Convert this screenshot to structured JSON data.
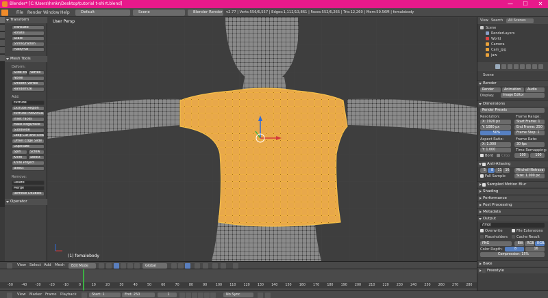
{
  "window": {
    "title": "Blender* [C:\\Users\\hmkr\\Desktop\\tutorial t-shirt.blend]",
    "minimize": "—",
    "maximize": "☐",
    "close": "✕"
  },
  "menubar": {
    "items": [
      "File",
      "Render",
      "Window",
      "Help"
    ],
    "screen_layout": "Default",
    "scene": "Scene",
    "engine": "Blender Render",
    "stats": "v2.77 | Verts:556/6,557 | Edges:1,112/13,861 | Faces:552/6,265 | Tris:12,260 | Mem:59.56M | femalebody"
  },
  "left_tabs": [
    "Tools",
    "Create",
    "Relations",
    "Animation",
    "Physics",
    "Grease Pencil"
  ],
  "tool_shelf": {
    "transform_header": "Transform",
    "transform_buttons": [
      "Translate",
      "Rotate",
      "Scale",
      "Shrink/Fatten",
      "Push/Pull"
    ],
    "mesh_tools_header": "Mesh Tools",
    "deform_label": "Deform:",
    "deform_buttons": [
      "Slide Ed",
      "Vertex",
      "Noise",
      "Smooth Vertex",
      "Randomize"
    ],
    "add_label": "Add:",
    "add_buttons": [
      "Extrude",
      "Extrude Region",
      "Extrude Individual",
      "Inset Faces",
      "Make Edge/Face",
      "Subdivide",
      "Loop Cut and Slide",
      "Offset Edge Slide",
      "Duplicate",
      "Spin",
      "Screw",
      "Knife",
      "Select",
      "Knife Project",
      "Bisect"
    ],
    "remove_label": "Remove:",
    "remove_buttons": [
      "Delete",
      "Merge",
      "Remove Doubles"
    ],
    "operator_header": "Operator"
  },
  "viewport": {
    "view_label": "User Persp",
    "object_label": "(1) femalebody"
  },
  "view3d_header": {
    "view": "View",
    "select": "Select",
    "add": "Add",
    "mesh": "Mesh",
    "mode": "Edit Mode",
    "orientation": "Global"
  },
  "timeline": {
    "ticks": [
      "-50",
      "-40",
      "-30",
      "-20",
      "-10",
      "0",
      "10",
      "20",
      "30",
      "40",
      "50",
      "60",
      "70",
      "80",
      "90",
      "100",
      "110",
      "120",
      "130",
      "140",
      "150",
      "160",
      "170",
      "180",
      "190",
      "200",
      "210",
      "220",
      "230",
      "240",
      "250",
      "260",
      "270",
      "280"
    ],
    "current_frame": 1
  },
  "bottom_bar": {
    "view": "View",
    "marker": "Marker",
    "frame": "Frame",
    "playback": "Playback",
    "start": "Start:",
    "start_value": "1",
    "end": "End:",
    "end_value": "250",
    "current": "1",
    "sync": "No Sync"
  },
  "outliner": {
    "view": "View",
    "search": "Search",
    "all_scenes": "All Scenes",
    "items": [
      {
        "label": "Scene",
        "color": "#c9c9c9"
      },
      {
        "label": "RenderLayers",
        "color": "#8aa0c8"
      },
      {
        "label": "World",
        "color": "#d44"
      },
      {
        "label": "Camera",
        "color": "#e9a23b"
      },
      {
        "label": "Cam_Jpg",
        "color": "#e9a23b"
      },
      {
        "label": "jaw",
        "color": "#e9a23b"
      }
    ]
  },
  "properties": {
    "scene": "Scene",
    "render_header": "Render",
    "render_buttons": [
      "Render",
      "Animation",
      "Audio"
    ],
    "display_label": "Display:",
    "display_value": "Image Editor",
    "dimensions_header": "Dimensions",
    "render_presets": "Render Presets",
    "resolution_label": "Resolution:",
    "res_x": "X:  1920 px",
    "res_y": "Y:  1080 px",
    "res_percent": "50%",
    "frame_range_label": "Frame Range:",
    "start_frame": "Start Frame: 1",
    "end_frame": "End Frame: 250",
    "frame_step": "Frame Step: 1",
    "aspect_label": "Aspect Ratio:",
    "aspect_x": "X:  1.000",
    "aspect_y": "Y:  1.000",
    "frame_rate_label": "Frame Rate:",
    "fps": "30 fps",
    "time_remap_label": "Time Remapping:",
    "remap_old": "100",
    "remap_new": "100",
    "border": "Bord",
    "crop": "Crop",
    "anti_alias_header": "Anti-Aliasing",
    "aa_samples": [
      "5",
      "8",
      "11",
      "16"
    ],
    "aa_filter": "Mitchell-Netravali",
    "full_sample": "Full Sample",
    "size": "Size: 1.000 px",
    "collapsed_panels": [
      "Sampled Motion Blur",
      "Shading",
      "Performance",
      "Post Processing",
      "Metadata"
    ],
    "output_header": "Output",
    "output_path": "/tmp\\",
    "overwrite": "Overwrite",
    "file_extensions": "File Extensions",
    "placeholders": "Placeholders",
    "cache_result": "Cache Result",
    "format": "PNG",
    "color_modes": [
      "BW",
      "RGB",
      "RGBA"
    ],
    "color_depth_label": "Color Depth:",
    "color_depths": [
      "8",
      "16"
    ],
    "compression": "Compression: 15%",
    "bake_header": "Bake",
    "freestyle_header": "Freestyle"
  }
}
